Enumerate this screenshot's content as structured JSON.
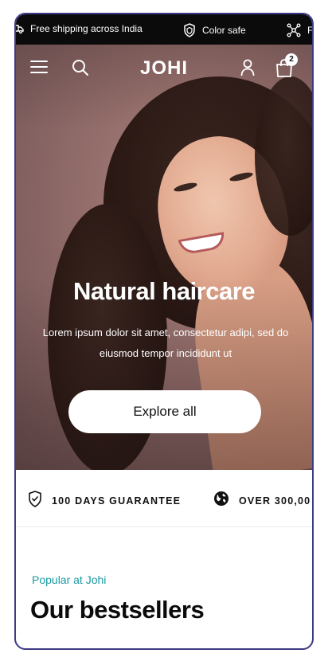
{
  "announcement": {
    "items": [
      {
        "icon": "truck-icon",
        "text": "Free shipping across India"
      },
      {
        "icon": "shield-icon",
        "text": "Color safe"
      },
      {
        "icon": "molecule-icon",
        "text": "F"
      }
    ]
  },
  "header": {
    "logo": "JOHI",
    "cart_count": "2",
    "icons": [
      "menu-icon",
      "search-icon",
      "user-icon",
      "bag-icon"
    ]
  },
  "hero": {
    "title": "Natural haircare",
    "subtitle": "Lorem ipsum dolor sit amet, consectetur adipi, sed do eiusmod tempor incididunt ut",
    "cta": "Explore all"
  },
  "trust": {
    "items": [
      {
        "icon": "shield-check-icon",
        "label": "100 DAYS GUARANTEE"
      },
      {
        "icon": "globe-icon",
        "label": "OVER 300,00"
      }
    ]
  },
  "bestsellers": {
    "eyebrow": "Popular at Johi",
    "title": "Our bestsellers"
  },
  "colors": {
    "accent": "#1a9aa3",
    "frame": "#3d3a86",
    "announce_bg": "#0b0b0b"
  }
}
